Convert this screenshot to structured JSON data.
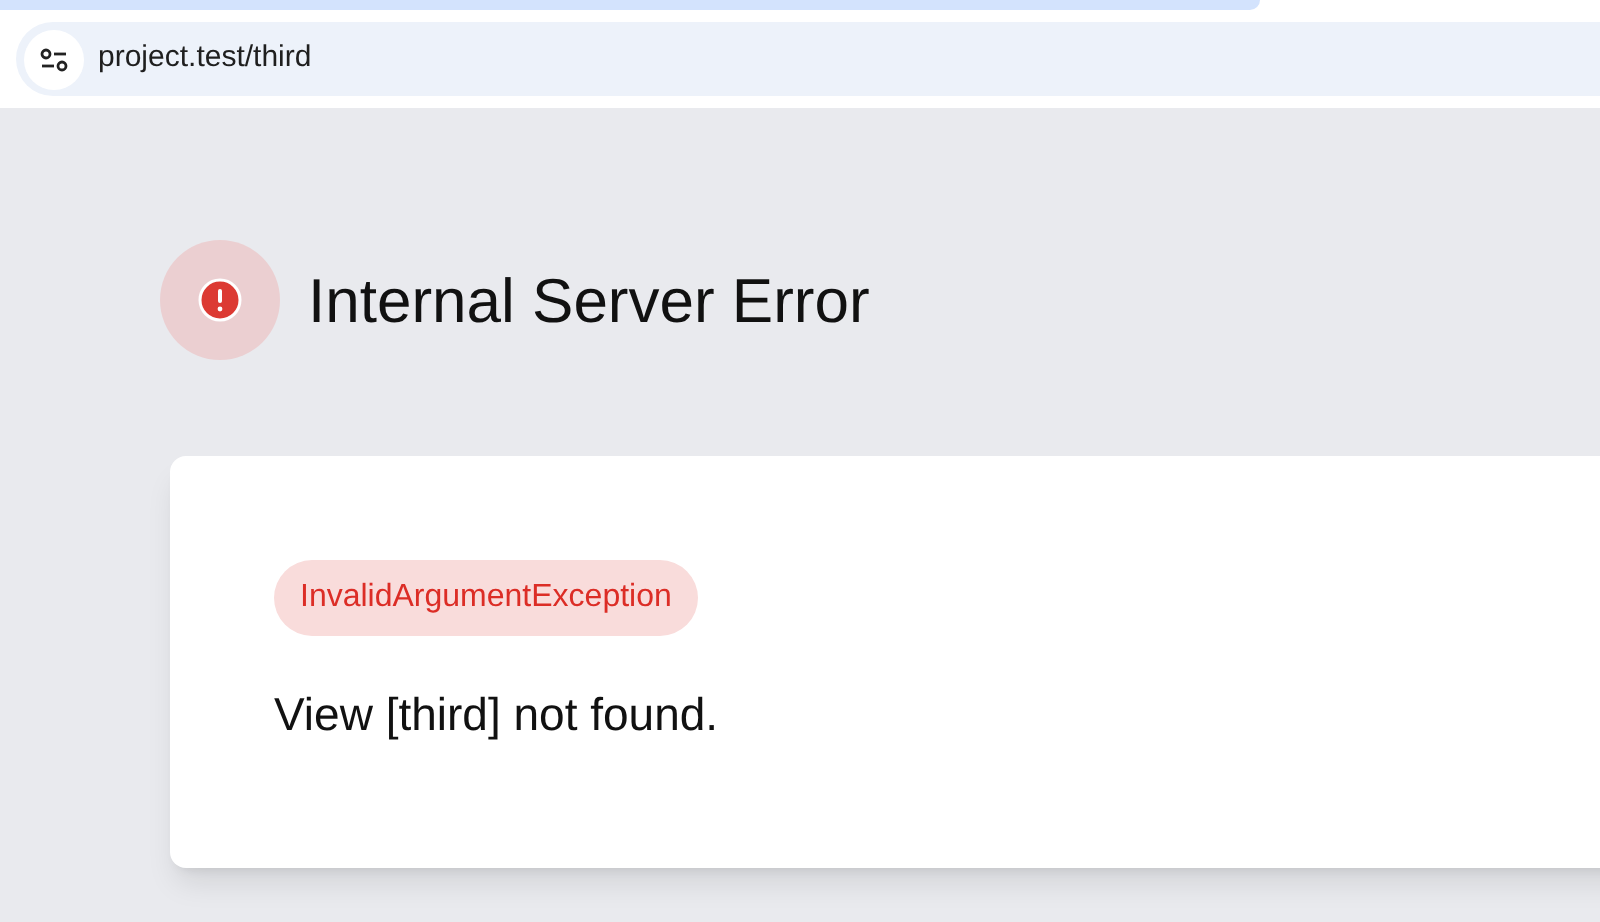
{
  "browser": {
    "url": "project.test/third"
  },
  "error": {
    "title": "Internal Server Error",
    "exception": "InvalidArgumentException",
    "message": "View [third] not found."
  }
}
